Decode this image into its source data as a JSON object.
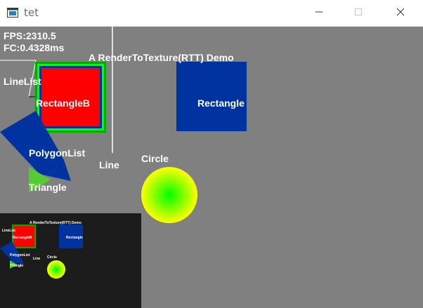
{
  "window": {
    "title": "tet",
    "controls": {
      "minimize": "minimize-icon",
      "maximize": "maximize-icon",
      "close": "close-icon"
    }
  },
  "hud": {
    "fps": "FPS:2310.5",
    "fc": "FC:0.4328ms"
  },
  "scene": {
    "title": "A RenderToTexture(RTT) Demo",
    "labels": {
      "linelist": "LineList",
      "rectangleb": "RectangleB",
      "rectangle": "Rectangle",
      "polygonlist": "PolygonList",
      "line": "Line",
      "circle": "Circle",
      "triangle": "Triangle"
    },
    "colors": {
      "background": "#808080",
      "red": "#ff0000",
      "blue": "#0033a0",
      "green": "#00ff00",
      "yellow": "#ffff00",
      "preview_background": "#1c1c1c"
    }
  },
  "preview": {
    "title": "A RenderToTexture(RTT) Demo",
    "labels": {
      "linelist": "LineList",
      "rectangleb": "RectangleB",
      "rectangle": "Rectangle",
      "polygonlist": "PolygonList",
      "line": "Line",
      "circle": "Circle",
      "triangle": "Triangle"
    }
  }
}
